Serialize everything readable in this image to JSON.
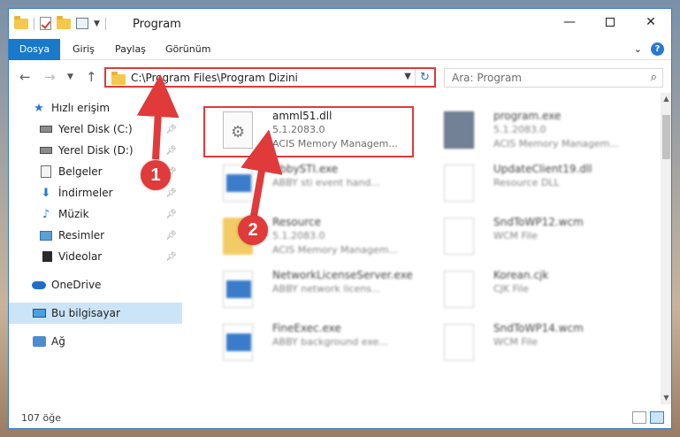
{
  "window": {
    "title": "Program"
  },
  "ribbon": {
    "tabs": [
      "Dosya",
      "Giriş",
      "Paylaş",
      "Görünüm"
    ]
  },
  "navbar": {
    "address": "C:\\Program Files\\Program Dizini",
    "search_placeholder": "Ara: Program"
  },
  "sidebar": {
    "items": [
      {
        "label": "Hızlı erişim",
        "icon": "star-icon"
      },
      {
        "label": "Yerel Disk (C:)",
        "icon": "drive-icon"
      },
      {
        "label": "Yerel Disk (D:)",
        "icon": "drive-icon"
      },
      {
        "label": "Belgeler",
        "icon": "documents-icon"
      },
      {
        "label": "İndirmeler",
        "icon": "download-icon"
      },
      {
        "label": "Müzik",
        "icon": "music-icon"
      },
      {
        "label": "Resimler",
        "icon": "pictures-icon"
      },
      {
        "label": "Videolar",
        "icon": "videos-icon"
      },
      {
        "label": "OneDrive",
        "icon": "cloud-icon"
      },
      {
        "label": "Bu bilgisayar",
        "icon": "computer-icon"
      },
      {
        "label": "Ağ",
        "icon": "network-icon"
      }
    ]
  },
  "files": [
    {
      "name": "amml51.dll",
      "meta1": "5.1.2083.0",
      "meta2": "ACIS Memory Managem..."
    },
    {
      "name": "program.exe",
      "meta1": "5.1.2083.0",
      "meta2": "ACIS Memory Managem..."
    },
    {
      "name": "AbbySTI.exe",
      "meta1": "ABBY sti event hand...",
      "meta2": ""
    },
    {
      "name": "UpdateClient19.dll",
      "meta1": "Resource DLL",
      "meta2": ""
    },
    {
      "name": "Resource",
      "meta1": "5.1.2083.0",
      "meta2": "ACIS Memory Managem..."
    },
    {
      "name": "SndToWP12.wcm",
      "meta1": "WCM File",
      "meta2": ""
    },
    {
      "name": "NetworkLicenseServer.exe",
      "meta1": "ABBY network licens...",
      "meta2": ""
    },
    {
      "name": "Korean.cjk",
      "meta1": "CJK File",
      "meta2": ""
    },
    {
      "name": "FineExec.exe",
      "meta1": "ABBY background exe...",
      "meta2": ""
    },
    {
      "name": "SndToWP14.wcm",
      "meta1": "WCM File",
      "meta2": ""
    }
  ],
  "status": {
    "count": "107 öğe"
  },
  "callouts": [
    "1",
    "2"
  ],
  "colors": {
    "accent": "#1979ca",
    "highlight": "#e03a3a",
    "selected": "#cce4f7"
  }
}
